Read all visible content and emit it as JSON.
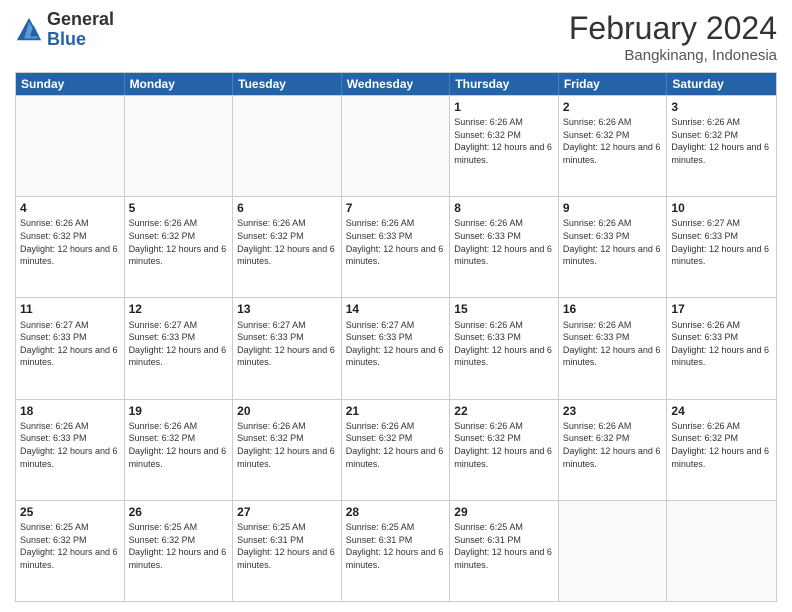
{
  "logo": {
    "general": "General",
    "blue": "Blue"
  },
  "title": {
    "main": "February 2024",
    "sub": "Bangkinang, Indonesia"
  },
  "calendar": {
    "headers": [
      "Sunday",
      "Monday",
      "Tuesday",
      "Wednesday",
      "Thursday",
      "Friday",
      "Saturday"
    ],
    "rows": [
      [
        {
          "day": "",
          "empty": true
        },
        {
          "day": "",
          "empty": true
        },
        {
          "day": "",
          "empty": true
        },
        {
          "day": "",
          "empty": true
        },
        {
          "day": "1",
          "sunrise": "6:26 AM",
          "sunset": "6:32 PM",
          "daylight": "12 hours and 6 minutes."
        },
        {
          "day": "2",
          "sunrise": "6:26 AM",
          "sunset": "6:32 PM",
          "daylight": "12 hours and 6 minutes."
        },
        {
          "day": "3",
          "sunrise": "6:26 AM",
          "sunset": "6:32 PM",
          "daylight": "12 hours and 6 minutes."
        }
      ],
      [
        {
          "day": "4",
          "sunrise": "6:26 AM",
          "sunset": "6:32 PM",
          "daylight": "12 hours and 6 minutes."
        },
        {
          "day": "5",
          "sunrise": "6:26 AM",
          "sunset": "6:32 PM",
          "daylight": "12 hours and 6 minutes."
        },
        {
          "day": "6",
          "sunrise": "6:26 AM",
          "sunset": "6:32 PM",
          "daylight": "12 hours and 6 minutes."
        },
        {
          "day": "7",
          "sunrise": "6:26 AM",
          "sunset": "6:33 PM",
          "daylight": "12 hours and 6 minutes."
        },
        {
          "day": "8",
          "sunrise": "6:26 AM",
          "sunset": "6:33 PM",
          "daylight": "12 hours and 6 minutes."
        },
        {
          "day": "9",
          "sunrise": "6:26 AM",
          "sunset": "6:33 PM",
          "daylight": "12 hours and 6 minutes."
        },
        {
          "day": "10",
          "sunrise": "6:27 AM",
          "sunset": "6:33 PM",
          "daylight": "12 hours and 6 minutes."
        }
      ],
      [
        {
          "day": "11",
          "sunrise": "6:27 AM",
          "sunset": "6:33 PM",
          "daylight": "12 hours and 6 minutes."
        },
        {
          "day": "12",
          "sunrise": "6:27 AM",
          "sunset": "6:33 PM",
          "daylight": "12 hours and 6 minutes."
        },
        {
          "day": "13",
          "sunrise": "6:27 AM",
          "sunset": "6:33 PM",
          "daylight": "12 hours and 6 minutes."
        },
        {
          "day": "14",
          "sunrise": "6:27 AM",
          "sunset": "6:33 PM",
          "daylight": "12 hours and 6 minutes."
        },
        {
          "day": "15",
          "sunrise": "6:26 AM",
          "sunset": "6:33 PM",
          "daylight": "12 hours and 6 minutes."
        },
        {
          "day": "16",
          "sunrise": "6:26 AM",
          "sunset": "6:33 PM",
          "daylight": "12 hours and 6 minutes."
        },
        {
          "day": "17",
          "sunrise": "6:26 AM",
          "sunset": "6:33 PM",
          "daylight": "12 hours and 6 minutes."
        }
      ],
      [
        {
          "day": "18",
          "sunrise": "6:26 AM",
          "sunset": "6:33 PM",
          "daylight": "12 hours and 6 minutes."
        },
        {
          "day": "19",
          "sunrise": "6:26 AM",
          "sunset": "6:32 PM",
          "daylight": "12 hours and 6 minutes."
        },
        {
          "day": "20",
          "sunrise": "6:26 AM",
          "sunset": "6:32 PM",
          "daylight": "12 hours and 6 minutes."
        },
        {
          "day": "21",
          "sunrise": "6:26 AM",
          "sunset": "6:32 PM",
          "daylight": "12 hours and 6 minutes."
        },
        {
          "day": "22",
          "sunrise": "6:26 AM",
          "sunset": "6:32 PM",
          "daylight": "12 hours and 6 minutes."
        },
        {
          "day": "23",
          "sunrise": "6:26 AM",
          "sunset": "6:32 PM",
          "daylight": "12 hours and 6 minutes."
        },
        {
          "day": "24",
          "sunrise": "6:26 AM",
          "sunset": "6:32 PM",
          "daylight": "12 hours and 6 minutes."
        }
      ],
      [
        {
          "day": "25",
          "sunrise": "6:25 AM",
          "sunset": "6:32 PM",
          "daylight": "12 hours and 6 minutes."
        },
        {
          "day": "26",
          "sunrise": "6:25 AM",
          "sunset": "6:32 PM",
          "daylight": "12 hours and 6 minutes."
        },
        {
          "day": "27",
          "sunrise": "6:25 AM",
          "sunset": "6:31 PM",
          "daylight": "12 hours and 6 minutes."
        },
        {
          "day": "28",
          "sunrise": "6:25 AM",
          "sunset": "6:31 PM",
          "daylight": "12 hours and 6 minutes."
        },
        {
          "day": "29",
          "sunrise": "6:25 AM",
          "sunset": "6:31 PM",
          "daylight": "12 hours and 6 minutes."
        },
        {
          "day": "",
          "empty": true
        },
        {
          "day": "",
          "empty": true
        }
      ]
    ]
  }
}
